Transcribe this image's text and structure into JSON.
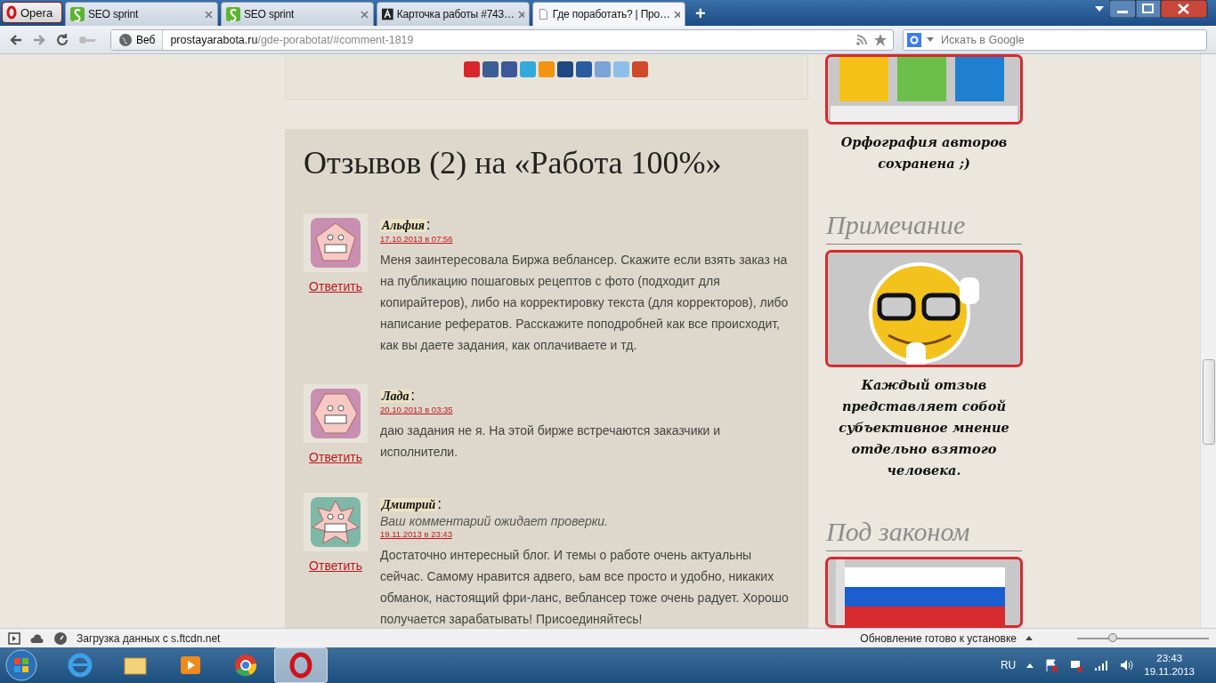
{
  "browser": {
    "menu_button": "Opera",
    "tabs": [
      {
        "title": "SEO sprint",
        "kind": "seo",
        "selected": false
      },
      {
        "title": "SEO sprint",
        "kind": "seo",
        "selected": false
      },
      {
        "title": "Карточка работы #743…",
        "kind": "letter",
        "selected": false
      },
      {
        "title": "Где поработать? | Про…",
        "kind": "page",
        "selected": true
      }
    ],
    "new_tab": "+",
    "address": {
      "badge": "Веб",
      "host": "prostayarabota.ru",
      "path": "/gde-porabotat/#comment-1819"
    },
    "search": {
      "placeholder": "Искать в Google"
    }
  },
  "share_buttons": [
    {
      "color": "#d9262c"
    },
    {
      "color": "#3b5f94"
    },
    {
      "color": "#3b5998"
    },
    {
      "color": "#33aadd"
    },
    {
      "color": "#f29312"
    },
    {
      "color": "#1c4a80"
    },
    {
      "color": "#2a5b9f"
    },
    {
      "color": "#7aa4d8"
    },
    {
      "color": "#8cc0e8"
    },
    {
      "color": "#d1482b"
    }
  ],
  "comments_section": {
    "title": "Отзывов (2) на «Работа 100%»",
    "comments": [
      {
        "author": "Альфия",
        "kind": "pentagon",
        "colon": ":",
        "date": "17.10.2013 в 07:56",
        "text": "Меня заинтересовала Биржа веблансер. Скажите если взять заказ на на публикацию пошаговых рецептов с фото (подходит для копирайтеров), либо на корректировку текста (для корректоров), либо написание рефератов. Расскажите поподробней как все происходит, как вы даете задания, как оплачиваете и тд.",
        "reply": "Ответить"
      },
      {
        "author": "Лада",
        "kind": "hexagon",
        "colon": ":",
        "date": "20.10.2013 в 03:35",
        "text": "даю задания не я. На этой бирже встречаются заказчики и исполнители.",
        "reply": "Ответить"
      },
      {
        "author": "Дмитрий",
        "kind": "star",
        "colon": ":",
        "moderation_note": "Ваш комментарий ожидает проверки.",
        "date": "19.11.2013 в 23:43",
        "text": "Достаточно интересный блог. И темы о работе очень актуальны сейчас. Самому нравится адвего, ьам все просто и удобно, никаких обманок, настоящий фри-ланс, веблансер тоже очень радует. Хорошо получается зарабатывать! Присоединяйтесь!",
        "reply": "Ответить"
      }
    ]
  },
  "sidebar": [
    {
      "kind": "letters",
      "caption": "Орфография авторов сохранена ;)"
    },
    {
      "kind": "smiley",
      "heading": "Примечание",
      "caption": "Каждый отзыв представляет собой субъективное мнение отдельно взятого человека."
    },
    {
      "kind": "flag",
      "heading": "Под законом"
    }
  ],
  "status_bar": {
    "loading": "Загрузка данных с s.ftcdn.net",
    "update": "Обновление готово к установке",
    "zoom": {
      "level": 0.28
    }
  },
  "taskbar": {
    "apps": [
      {
        "kind": "ie",
        "selected": false
      },
      {
        "kind": "folder",
        "selected": false
      },
      {
        "kind": "media",
        "selected": false
      },
      {
        "kind": "chrome",
        "selected": false
      },
      {
        "kind": "opera",
        "selected": true
      }
    ],
    "language": "RU",
    "time": "23:43",
    "date": "19.11.2013"
  }
}
